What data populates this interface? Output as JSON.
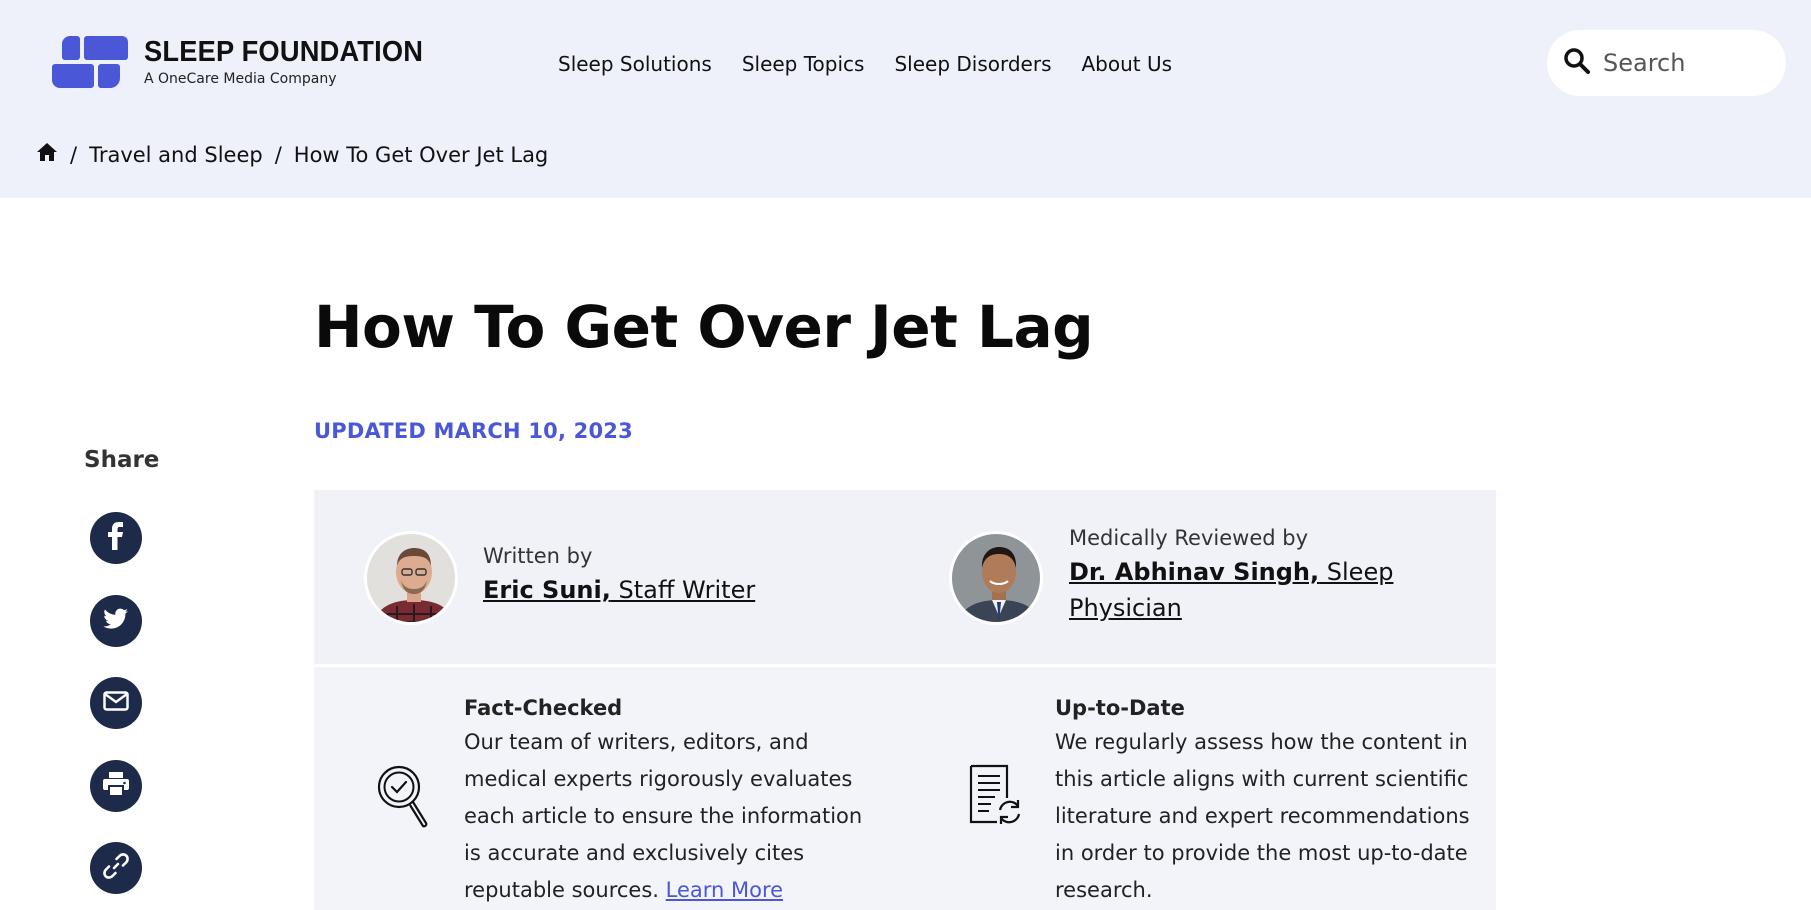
{
  "brand": {
    "title": "SLEEP FOUNDATION",
    "subtitle": "A OneCare Media Company",
    "color": "#4a57d6"
  },
  "nav": {
    "items": [
      "Sleep Solutions",
      "Sleep Topics",
      "Sleep Disorders",
      "About Us"
    ]
  },
  "search": {
    "placeholder": "Search"
  },
  "breadcrumb": {
    "items": [
      "Travel and Sleep",
      "How To Get Over Jet Lag"
    ]
  },
  "article": {
    "title": "How To Get Over Jet Lag",
    "updated": "UPDATED MARCH 10, 2023"
  },
  "share": {
    "label": "Share",
    "buttons": [
      "facebook-icon",
      "twitter-icon",
      "email-icon",
      "print-icon",
      "link-icon"
    ]
  },
  "authors": {
    "writer": {
      "label": "Written by",
      "name": "Eric Suni,",
      "role": " Staff Writer"
    },
    "reviewer": {
      "label": "Medically Reviewed by",
      "name": "Dr. Abhinav Singh,",
      "role": " Sleep Physician"
    }
  },
  "features": {
    "fact": {
      "title": "Fact-Checked",
      "text": "Our team of writers, editors, and medical experts rigorously evaluates each article to ensure the information is accurate and exclusively cites reputable sources.",
      "link": "Learn More"
    },
    "uptodate": {
      "title": "Up-to-Date",
      "text": "We regularly assess how the content in this article aligns with current scientific literature and expert recommendations in order to provide the most up-to-date research."
    }
  }
}
